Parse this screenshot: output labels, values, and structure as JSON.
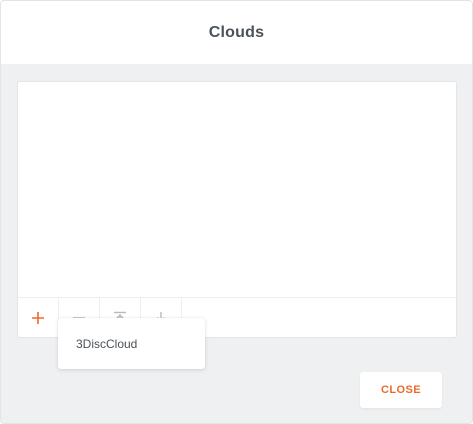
{
  "dialog": {
    "title": "Clouds"
  },
  "toolbar": {
    "buttons": [
      {
        "icon": "plus-icon",
        "color": "#ec6a2b"
      },
      {
        "icon": "minus-icon",
        "color": "#b8bcc0"
      },
      {
        "icon": "move-top-icon",
        "color": "#b8bcc0"
      },
      {
        "icon": "move-bottom-icon",
        "color": "#b8bcc0"
      }
    ]
  },
  "add_menu": {
    "items": [
      {
        "label": "3DiscCloud"
      }
    ]
  },
  "footer": {
    "close_label": "CLOSE"
  },
  "colors": {
    "accent": "#ec6a2b",
    "title_text": "#4b5259",
    "muted_icon": "#b8bcc0",
    "backdrop": "#eff0f1"
  }
}
